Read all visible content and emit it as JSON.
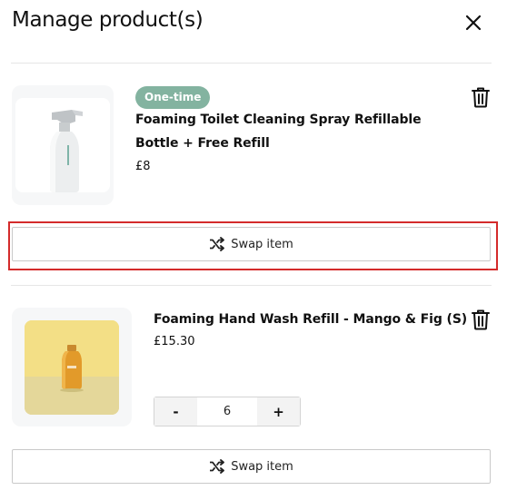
{
  "header": {
    "title": "Manage product(s)",
    "close_icon": "close-icon"
  },
  "products": [
    {
      "badge": "One-time",
      "name": "Foaming Toilet Cleaning Spray Refillable Bottle + Free Refill",
      "price": "£8",
      "image": "spray-bottle",
      "delete_icon": "trash-icon",
      "swap_label": "Swap item",
      "swap_icon": "shuffle-icon"
    },
    {
      "name": "Foaming Hand Wash Refill - Mango & Fig (S)",
      "price": "£15.30",
      "image": "hand-wash-bottle",
      "delete_icon": "trash-icon",
      "quantity": {
        "decrement_label": "-",
        "value": "6",
        "increment_label": "+"
      },
      "swap_label": "Swap item",
      "swap_icon": "shuffle-icon"
    }
  ],
  "colors": {
    "badge_bg": "#83b3a0",
    "focus_outline": "#d42b2b",
    "thumb_bg": "#f6f7f8",
    "product2_image_bg": "#f0dc8e"
  }
}
